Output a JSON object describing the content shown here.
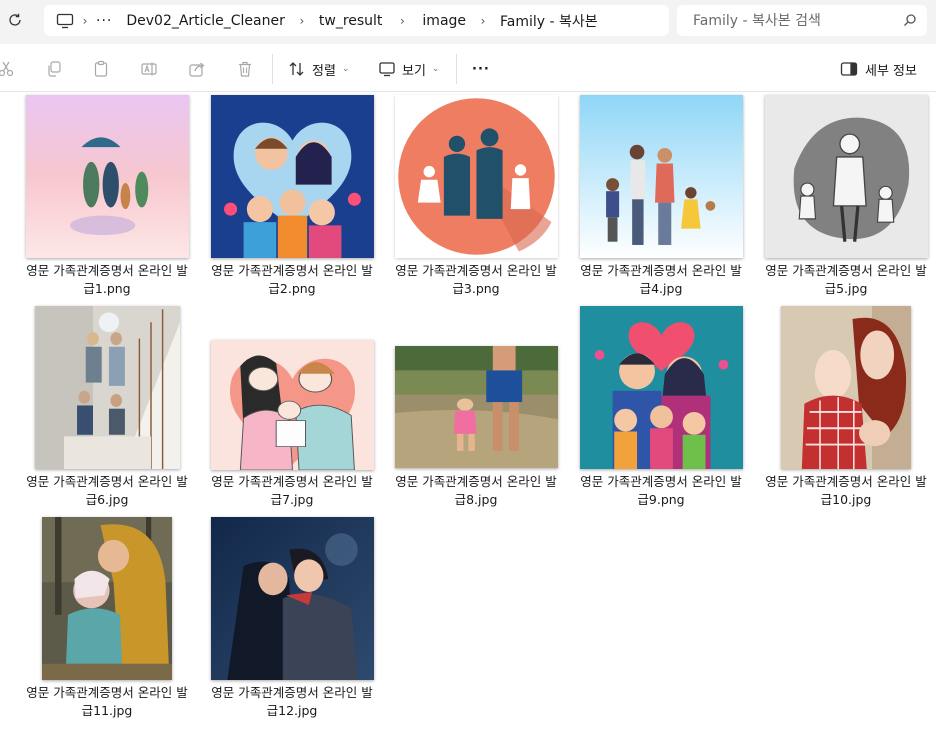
{
  "address": {
    "crumbs": [
      "Dev02_Article_Cleaner",
      "tw_result",
      "image",
      "Family - 복사본"
    ],
    "overflow": "···"
  },
  "search": {
    "placeholder": "Family - 복사본 검색"
  },
  "toolbar": {
    "sort_label": "정렬",
    "view_label": "보기",
    "more_label": "···",
    "details_label": "세부 정보"
  },
  "files": [
    {
      "line1": "영문 가족관계증명서 온라인 발",
      "line2": "급1.png",
      "icon": "family-umbrella-thumbnail"
    },
    {
      "line1": "영문 가족관계증명서 온라인 발",
      "line2": "급2.png",
      "icon": "cartoon-family-heart-thumbnail"
    },
    {
      "line1": "영문 가족관계증명서 온라인 발",
      "line2": "급3.png",
      "icon": "family-silhouette-circle-thumbnail"
    },
    {
      "line1": "영문 가족관계증명서 온라인 발",
      "line2": "급4.jpg",
      "icon": "cartoon-family-standing-thumbnail"
    },
    {
      "line1": "영문 가족관계증명서 온라인 발",
      "line2": "급5.jpg",
      "icon": "sketch-mother-children-thumbnail"
    },
    {
      "line1": "영문 가족관계증명서 온라인 발",
      "line2": "급6.jpg",
      "icon": "family-staircase-photo-thumbnail"
    },
    {
      "line1": "영문 가족관계증명서 온라인 발",
      "line2": "급7.jpg",
      "icon": "drawn-parents-baby-thumbnail"
    },
    {
      "line1": "영문 가족관계증명서 온라인 발",
      "line2": "급8.jpg",
      "icon": "beach-father-child-photo-thumbnail"
    },
    {
      "line1": "영문 가족관계증명서 온라인 발",
      "line2": "급9.png",
      "icon": "cartoon-family-teal-thumbnail"
    },
    {
      "line1": "영문 가족관계증명서 온라인 발",
      "line2": "급10.jpg",
      "icon": "mother-baby-photo-thumbnail"
    },
    {
      "line1": "영문 가족관계증명서 온라인 발",
      "line2": "급11.jpg",
      "icon": "mother-child-kiss-photo-thumbnail"
    },
    {
      "line1": "영문 가족관계증명서 온라인 발",
      "line2": "급12.jpg",
      "icon": "child-kiss-night-photo-thumbnail"
    }
  ]
}
